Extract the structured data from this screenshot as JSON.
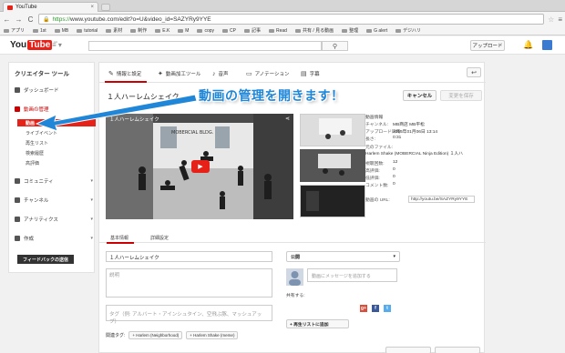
{
  "browser": {
    "tab_title": "YouTube",
    "tab_close": "×",
    "back": "←",
    "forward": "→",
    "reload": "C",
    "url_scheme": "https://",
    "url_rest": "www.youtube.com/edit?o=U&video_id=SAZYRy9YYE",
    "menu": "≡",
    "bookmarks": [
      "アプリ",
      "1st",
      "MB",
      "tutorial",
      "素材",
      "制作",
      "E.K",
      "M",
      "copy",
      "CP",
      "記事",
      "Read",
      "共有 / 見る動画",
      "整理",
      "G alert",
      "デジハリ"
    ]
  },
  "youtube_header": {
    "logo_you": "You",
    "logo_tube": "Tube",
    "logo_region": "JP",
    "upload": "アップロード"
  },
  "sidebar": {
    "title": "クリエイター ツール",
    "dashboard": "ダッシュボード",
    "video_manager": "動画の管理",
    "sub_items": [
      "動画",
      "ライブイベント",
      "再生リスト",
      "検索履歴",
      "高評価"
    ],
    "community": "コミュニティ",
    "channel": "チャンネル",
    "analytics": "アナリティクス",
    "create": "作成",
    "feedback": "フィードバックの送信"
  },
  "editor": {
    "tabs": [
      "情報と設定",
      "動画加工ツール",
      "音声",
      "アノテーション",
      "字幕"
    ],
    "video_title": "１人ハーレムシェイク",
    "cancel": "キャンセル",
    "save": "変更を保存",
    "player_title": "１人ハーレムシェイク",
    "player_sign": "MOBERCIAL BLDG.",
    "meta": {
      "header": "動画情報",
      "rows": [
        {
          "k": "チャンネル:",
          "v": "MB商店 MB平松"
        },
        {
          "k": "アップロード日時:",
          "v": "2015年01月06日 13:14"
        },
        {
          "k": "長さ:",
          "v": "0:31"
        },
        {
          "k": "元のファイル:",
          "v": ""
        },
        {
          "k": "",
          "v": "Harlem Shake (MOBERCIAL Ninja Edition) １人ハ"
        },
        {
          "k": "視聴回数:",
          "v": "12"
        },
        {
          "k": "高評価:",
          "v": "0"
        },
        {
          "k": "低評価:",
          "v": "0"
        },
        {
          "k": "コメント数:",
          "v": "0"
        }
      ],
      "url_label": "動画の URL:",
      "url_value": "http://youtu.be/SAZYRy9YYE"
    },
    "subtabs": [
      "基本情報",
      "詳細設定"
    ],
    "title_value": "１人ハーレムシェイク",
    "desc_placeholder": "説明",
    "tags_placeholder": "タグ（例: アルバート・アインシュタイン、空飛ぶ豚、マッシュアップ）",
    "related_tags_label": "関連タグ:",
    "related_tags": [
      "+ Harlem (Neighborhood)",
      "+ Harlem Shake (meme)"
    ],
    "privacy": "公開",
    "message_placeholder": "動画にメッセージを追加する",
    "share_label": "共有する:",
    "add_playlist": "+ 再生リストに追加"
  },
  "callout": "動画の管理を開きます！",
  "colors": {
    "accent": "#e62117",
    "callout": "#1f86d8"
  }
}
